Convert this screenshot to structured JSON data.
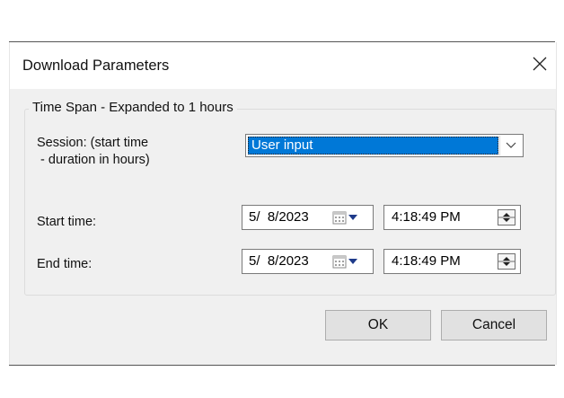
{
  "dialog": {
    "title": "Download Parameters",
    "close_icon": "close-x-icon"
  },
  "group": {
    "label": "Time Span - Expanded to 1 hours"
  },
  "session": {
    "label_line1": "Session:  (start time",
    "label_line2": " - duration in hours)",
    "selected_value": "User input",
    "dropdown_icon": "chevron-down-icon"
  },
  "start": {
    "label": "Start time:",
    "date": "5/  8/2023",
    "time": "4:18:49 PM",
    "calendar_icon": "calendar-dropdown-icon",
    "spin_icon": "spin-updown-icon"
  },
  "end": {
    "label": "End time:",
    "date": "5/  8/2023",
    "time": "4:18:49 PM",
    "calendar_icon": "calendar-dropdown-icon",
    "spin_icon": "spin-updown-icon"
  },
  "buttons": {
    "ok": "OK",
    "cancel": "Cancel"
  },
  "colors": {
    "selection": "#0078d7",
    "dialog_bg": "#f0f0f0",
    "button_bg": "#e1e1e1"
  }
}
